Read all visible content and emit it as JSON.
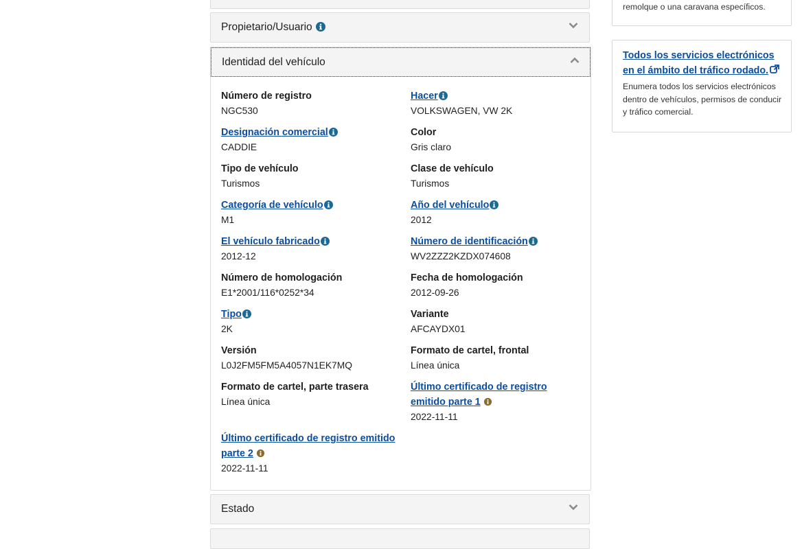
{
  "accordion": {
    "owner": {
      "label": "Propietario/Usuario"
    },
    "identity": {
      "label": "Identidad del vehículo",
      "fields": [
        {
          "label": "Número de registro",
          "value": "NGC530",
          "link": false
        },
        {
          "label": "Hacer",
          "value": "VOLKSWAGEN, VW 2K",
          "link": true,
          "icon": "blue"
        },
        {
          "label": "Designación comercial",
          "value": "CADDIE",
          "link": true,
          "icon": "blue"
        },
        {
          "label": "Color",
          "value": "Gris claro",
          "link": false
        },
        {
          "label": "Tipo de vehículo",
          "value": "Turismos",
          "link": false
        },
        {
          "label": "Clase de vehículo",
          "value": "Turismos",
          "link": false
        },
        {
          "label": "Categoría de vehículo",
          "value": "M1",
          "link": true,
          "icon": "blue"
        },
        {
          "label": "Año del vehículo",
          "value": "2012",
          "link": true,
          "icon": "blue"
        },
        {
          "label": "El vehículo fabricado",
          "value": "2012-12",
          "link": true,
          "icon": "blue"
        },
        {
          "label": "Número de identificación",
          "value": "WV2ZZZ2KZDX074608",
          "link": true,
          "icon": "blue"
        },
        {
          "label": "Número de homologación",
          "value": "E1*2001/116*0252*34",
          "link": false
        },
        {
          "label": "Fecha de homologación",
          "value": "2012-09-26",
          "link": false
        },
        {
          "label": "Tipo",
          "value": "2K",
          "link": true,
          "icon": "blue"
        },
        {
          "label": "Variante",
          "value": "AFCAYDX01",
          "link": false
        },
        {
          "label": "Versión",
          "value": "L0J2FM5FM5A4057N1EK7MQ",
          "link": false
        },
        {
          "label": "Formato de cartel, frontal",
          "value": "Línea única",
          "link": false
        },
        {
          "label": "Formato de cartel, parte trasera",
          "value": "Línea única",
          "link": false
        },
        {
          "label": "Último certificado de registro emitido parte 1",
          "value": "2022-11-11",
          "link": true,
          "icon": "brown"
        },
        {
          "label": "Último certificado de registro emitido parte 2",
          "value": "2022-11-11",
          "link": true,
          "icon": "brown"
        }
      ]
    },
    "status": {
      "label": "Estado"
    }
  },
  "sidebar": {
    "card1": {
      "desc": "remolque o una caravana específicos."
    },
    "card2": {
      "title": "Todos los servicios electrónicos en el ámbito del tráfico rodado.",
      "desc": "Enumera todos los servicios electrónicos dentro de vehículos, permisos de conducir y tráfico comercial."
    }
  },
  "colors": {
    "link": "#0b4ea2",
    "info_blue": "#1b6a96",
    "info_brown": "#8a6d2e",
    "panel_bg": "#f4f4f4"
  },
  "icons": {
    "info": "info-circle-icon",
    "chevron_down": "chevron-down-icon",
    "chevron_up": "chevron-up-icon",
    "external": "external-link-icon"
  }
}
